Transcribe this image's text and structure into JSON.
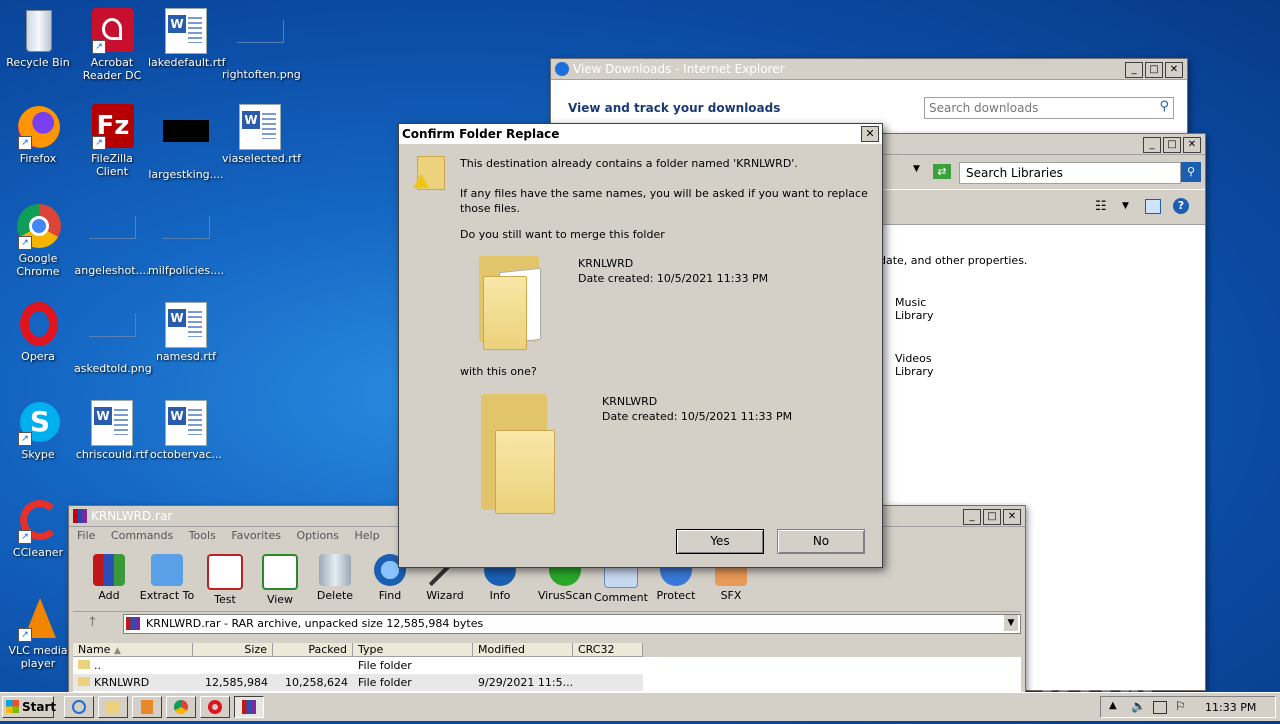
{
  "desktop": {
    "icons": [
      {
        "label": "Recycle Bin",
        "icon": "recycle-bin-icon"
      },
      {
        "label": "Acrobat Reader DC",
        "icon": "acrobat-icon"
      },
      {
        "label": "lakedefault.rtf",
        "icon": "word-doc-icon"
      },
      {
        "label": "rightoften.png",
        "icon": "image-icon"
      },
      {
        "label": "Firefox",
        "icon": "firefox-icon"
      },
      {
        "label": "FileZilla Client",
        "icon": "filezilla-icon"
      },
      {
        "label": "largestking....",
        "icon": "image-icon"
      },
      {
        "label": "viaselected.rtf",
        "icon": "word-doc-icon"
      },
      {
        "label": "Google Chrome",
        "icon": "chrome-icon"
      },
      {
        "label": "angeleshot....",
        "icon": "image-icon"
      },
      {
        "label": "milfpolicies....",
        "icon": "image-icon"
      },
      {
        "label": "Opera",
        "icon": "opera-icon"
      },
      {
        "label": "askedtold.png",
        "icon": "image-icon"
      },
      {
        "label": "namesd.rtf",
        "icon": "word-doc-icon"
      },
      {
        "label": "Skype",
        "icon": "skype-icon"
      },
      {
        "label": "chriscould.rtf",
        "icon": "word-doc-icon"
      },
      {
        "label": "octobervac...",
        "icon": "word-doc-icon"
      },
      {
        "label": "CCleaner",
        "icon": "ccleaner-icon"
      },
      {
        "label": "VLC media player",
        "icon": "vlc-icon"
      }
    ]
  },
  "ie_window": {
    "title": "View Downloads - Internet Explorer",
    "heading": "View and track your downloads",
    "search_placeholder": "Search downloads"
  },
  "explorer_window": {
    "search_placeholder": "Search Libraries",
    "desc_text": "date, and other properties.",
    "libraries": [
      {
        "line1": "Music",
        "line2": "Library"
      },
      {
        "line1": "Videos",
        "line2": "Library"
      }
    ]
  },
  "dialog": {
    "title": "Confirm Folder Replace",
    "line1": "This destination already contains a folder named 'KRNLWRD'.",
    "line2a": "If any files have the same names, you will be asked if you want to replace",
    "line2b": "those files.",
    "line3": "Do you still want to merge this folder",
    "existing_name": "KRNLWRD",
    "existing_date": "Date created: 10/5/2021 11:33 PM",
    "with_text": "with this one?",
    "new_name": "KRNLWRD",
    "new_date": "Date created: 10/5/2021 11:33 PM",
    "yes_label": "Yes",
    "no_label": "No"
  },
  "winrar": {
    "title": "KRNLWRD.rar",
    "menu": [
      "File",
      "Commands",
      "Tools",
      "Favorites",
      "Options",
      "Help"
    ],
    "tools": [
      "Add",
      "Extract To",
      "Test",
      "View",
      "Delete",
      "Find",
      "Wizard",
      "Info",
      "VirusScan",
      "Comment",
      "Protect",
      "SFX"
    ],
    "path_text": "KRNLWRD.rar - RAR archive, unpacked size 12,585,984 bytes",
    "columns": [
      "Name",
      "Size",
      "Packed",
      "Type",
      "Modified",
      "CRC32"
    ],
    "rows": [
      {
        "name": "..",
        "size": "",
        "packed": "",
        "type": "File folder",
        "modified": ""
      },
      {
        "name": "KRNLWRD",
        "size": "12,585,984",
        "packed": "10,258,624",
        "type": "File folder",
        "modified": "9/29/2021 11:5..."
      }
    ]
  },
  "taskbar": {
    "start_label": "Start",
    "clock": "11:33 PM"
  },
  "watermark": "ANY RUN"
}
